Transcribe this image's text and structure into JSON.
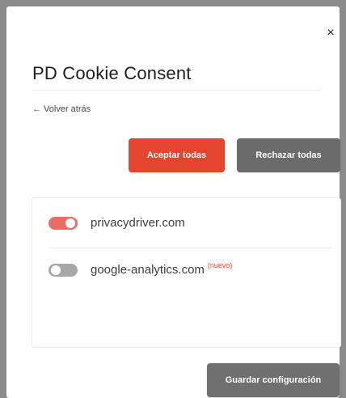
{
  "modal": {
    "close_label": "×",
    "title": "PD Cookie Consent",
    "back_label": "← Volver atrás"
  },
  "actions": {
    "accept_all_label": "Aceptar todas",
    "reject_all_label": "Rechazar todas",
    "save_label": "Guardar configuración"
  },
  "providers": [
    {
      "domain": "privacydriver.com",
      "enabled": true,
      "tag": ""
    },
    {
      "domain": "google-analytics.com",
      "enabled": false,
      "tag": "(nuevo)"
    }
  ],
  "colors": {
    "accent": "#e5452f",
    "toggle_on": "#ea6c63",
    "toggle_off": "#a7a7a7",
    "secondary_button": "#6b6b6b"
  }
}
